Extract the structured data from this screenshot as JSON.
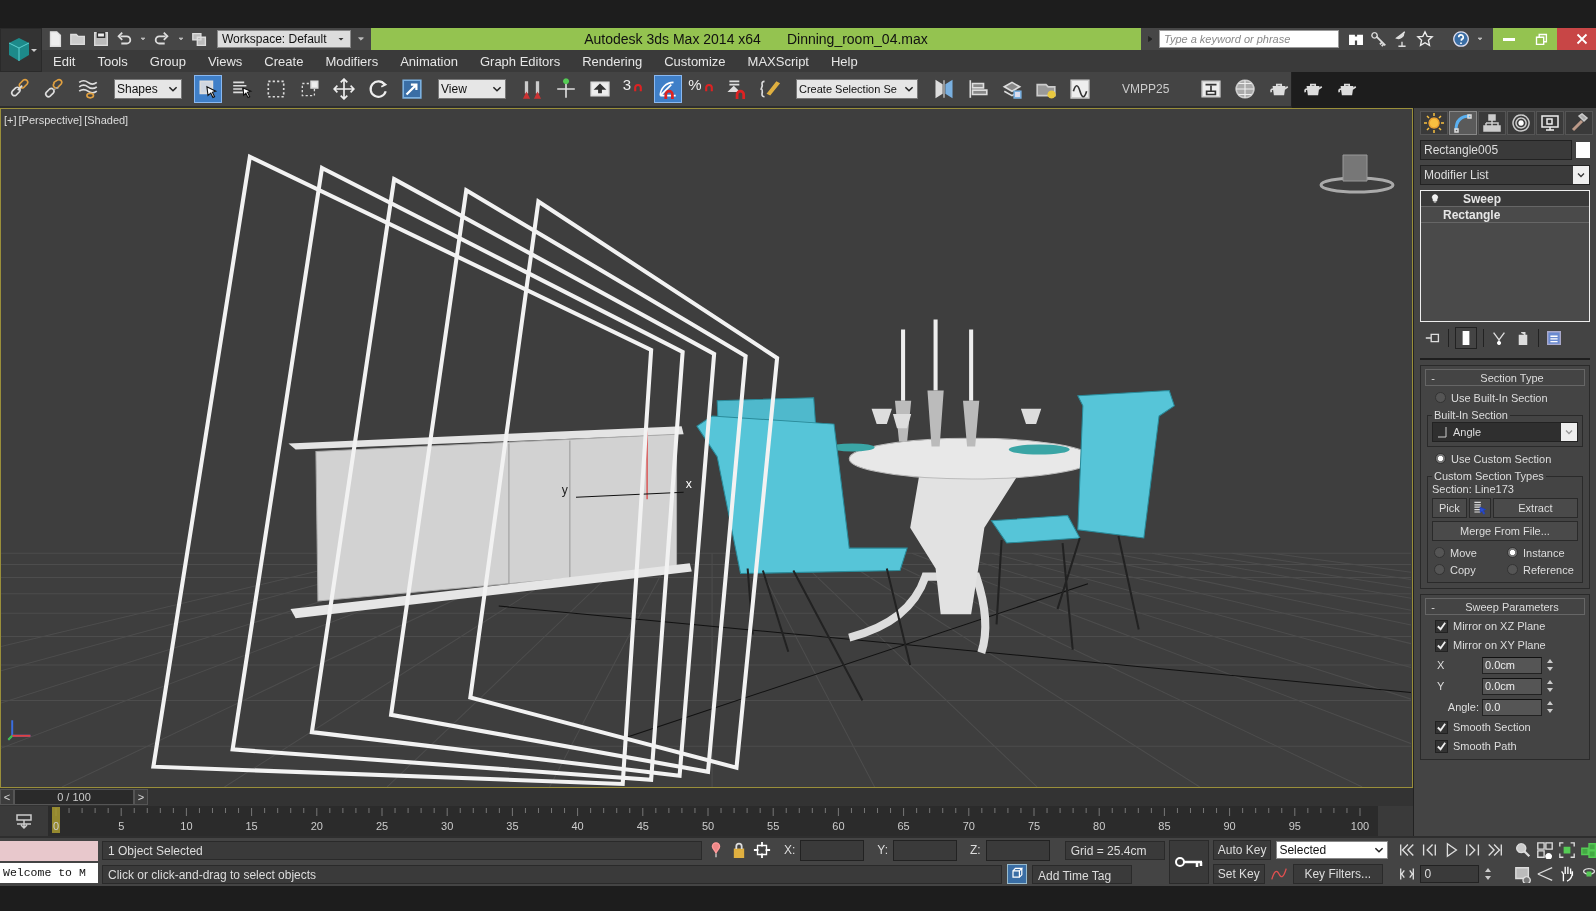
{
  "title_bar": {
    "workspace": "Workspace: Default",
    "title": "Autodesk 3ds Max  2014 x64",
    "file": "Dinning_room_04.max",
    "search": {
      "placeholder": "Type a keyword or phrase"
    }
  },
  "menu": [
    "Edit",
    "Tools",
    "Group",
    "Views",
    "Create",
    "Modifiers",
    "Animation",
    "Graph Editors",
    "Rendering",
    "Customize",
    "MAXScript",
    "Help"
  ],
  "toolbar": [
    {
      "kind": "button",
      "selected": false
    },
    {
      "kind": "button",
      "selected": false
    },
    {
      "kind": "button",
      "selected": false
    },
    {
      "kind": "dropdown",
      "value": "Shapes"
    },
    {
      "kind": "button",
      "selected": true
    },
    {
      "kind": "button",
      "selected": false
    },
    {
      "kind": "button",
      "selected": false
    },
    {
      "kind": "button",
      "selected": false
    },
    {
      "kind": "button",
      "selected": false
    },
    {
      "kind": "button",
      "selected": false
    },
    {
      "kind": "button",
      "selected": false
    },
    {
      "kind": "dropdown",
      "value": "View"
    },
    {
      "kind": "button",
      "selected": false
    },
    {
      "kind": "button",
      "selected": false
    },
    {
      "kind": "button",
      "selected": false
    },
    {
      "kind": "snap",
      "label": "3",
      "selected": false
    },
    {
      "kind": "snap",
      "selected": true
    },
    {
      "kind": "snap",
      "label": "%",
      "selected": false
    },
    {
      "kind": "snap",
      "selected": false
    },
    {
      "kind": "button",
      "selected": false
    },
    {
      "kind": "dropdown",
      "value": "Create Selection Se"
    },
    {
      "kind": "button",
      "selected": false
    },
    {
      "kind": "button",
      "selected": false
    },
    {
      "kind": "button",
      "selected": false
    },
    {
      "kind": "button",
      "selected": false
    },
    {
      "kind": "button",
      "selected": false
    },
    {
      "kind": "label",
      "text": "VMPP25"
    },
    {
      "kind": "button",
      "selected": false
    },
    {
      "kind": "button",
      "selected": false
    },
    {
      "kind": "button",
      "selected": false
    },
    {
      "kind": "button",
      "selected": false
    },
    {
      "kind": "button",
      "selected": false
    }
  ],
  "viewport": {
    "labels": [
      "[+]",
      "[Perspective]",
      "[Shaded]"
    ],
    "gizmo_labels": [
      "y",
      "x"
    ]
  },
  "command_panel": {
    "tabs": [
      {
        "selected": false
      },
      {
        "selected": true
      },
      {
        "selected": false
      },
      {
        "selected": false
      },
      {
        "selected": false
      },
      {
        "selected": false
      }
    ],
    "object_name": "Rectangle005",
    "modifier_list": "Modifier List",
    "stack": [
      {
        "kind": "modifier",
        "label": "Sweep",
        "selected": true
      },
      {
        "kind": "object",
        "label": "Rectangle",
        "selected": false
      }
    ],
    "section_type": {
      "sign": "-",
      "title": "Section Type",
      "builtin_radio": {
        "label": "Use Built-In Section",
        "selected": false
      },
      "builtin_group": "Built-In Section",
      "builtin_value": "Angle",
      "custom_radio": {
        "label": "Use Custom Section",
        "selected": true
      },
      "custom_group": "Custom Section Types",
      "section_label": "Section: Line173",
      "buttons": [
        "Pick",
        "Extract"
      ],
      "merge": "Merge From File...",
      "modes": [
        {
          "label": "Move",
          "selected": false
        },
        {
          "label": "Instance",
          "selected": true
        },
        {
          "label": "Copy",
          "selected": false
        },
        {
          "label": "Reference",
          "selected": false
        }
      ]
    },
    "sweep_parameters": {
      "sign": "-",
      "title": "Sweep Parameters",
      "mirrors": [
        {
          "label": "Mirror on XZ Plane",
          "checked": true
        },
        {
          "label": "Mirror on XY Plane",
          "checked": true
        }
      ],
      "spinners": [
        {
          "label": "X",
          "value": "0.0cm"
        },
        {
          "label": "Y",
          "value": "0.0cm"
        },
        {
          "label": "Angle:",
          "value": "0.0"
        }
      ],
      "smoothing": [
        {
          "label": "Smooth Section",
          "checked": true
        },
        {
          "label": "Smooth Path",
          "checked": true
        }
      ]
    }
  },
  "timeslider": {
    "prev": "<",
    "position": "0 / 100",
    "next": ">",
    "level": 0
  },
  "trackbar": {
    "labels": [
      "0",
      "5",
      "10",
      "15",
      "20",
      "25",
      "30",
      "35",
      "40",
      "45",
      "50",
      "55",
      "60",
      "65",
      "70",
      "75",
      "80",
      "85",
      "90",
      "95",
      "100"
    ],
    "level": 0
  },
  "status": {
    "maxscript_text": "Welcome to M",
    "selection": "1 Object Selected",
    "prompt": "Click or click-and-drag to select objects",
    "coords": [
      "X:",
      "Y:",
      "Z:"
    ],
    "grid": "Grid = 25.4cm",
    "time_tag": "Add Time Tag",
    "auto_key": "Auto Key",
    "set_key": "Set Key",
    "key_mode": "Selected",
    "key_filters": "Key Filters...",
    "frame": "0"
  }
}
